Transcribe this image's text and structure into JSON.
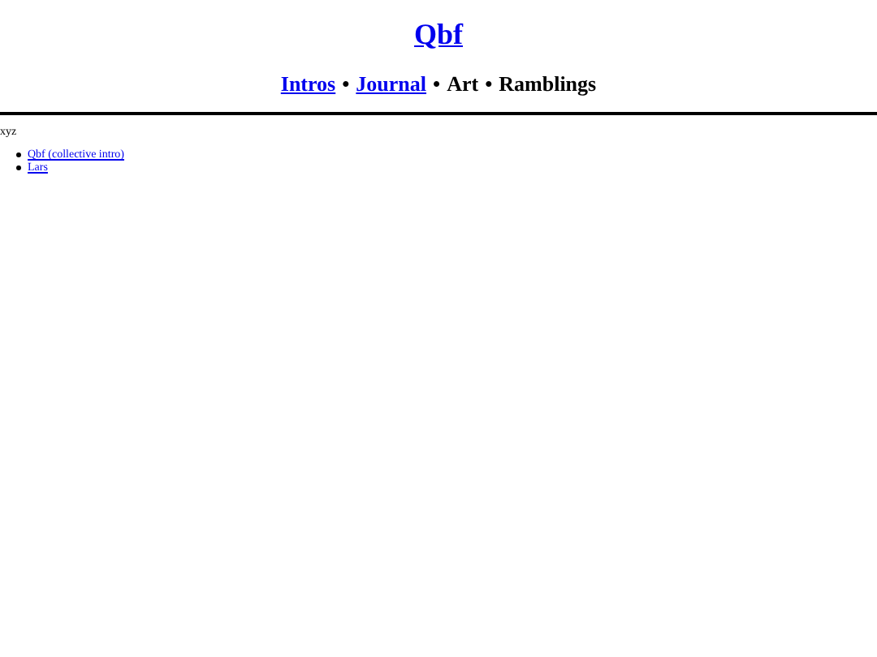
{
  "header": {
    "title": "Qbf"
  },
  "nav": {
    "separator": "•",
    "items": [
      {
        "label": "Intros",
        "kind": "link"
      },
      {
        "label": "Journal",
        "kind": "link"
      },
      {
        "label": "Art",
        "kind": "text"
      },
      {
        "label": "Ramblings",
        "kind": "text"
      }
    ]
  },
  "content": {
    "heading": "xyz",
    "links": [
      "Qbf (collective intro)",
      "Lars"
    ]
  }
}
